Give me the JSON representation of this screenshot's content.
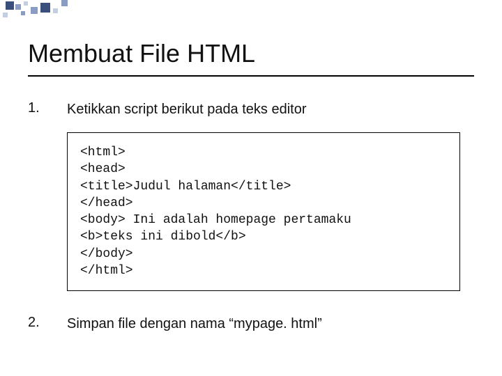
{
  "title": "Membuat File HTML",
  "steps": {
    "one": {
      "number": "1.",
      "text": "Ketikkan script berikut pada teks editor"
    },
    "two": {
      "number": "2.",
      "text": "Simpan file dengan nama “mypage. html”"
    }
  },
  "code": "<html>\n<head>\n<title>Judul halaman</title>\n</head>\n<body> Ini adalah homepage pertamaku\n<b>teks ini dibold</b>\n</body>\n</html>"
}
